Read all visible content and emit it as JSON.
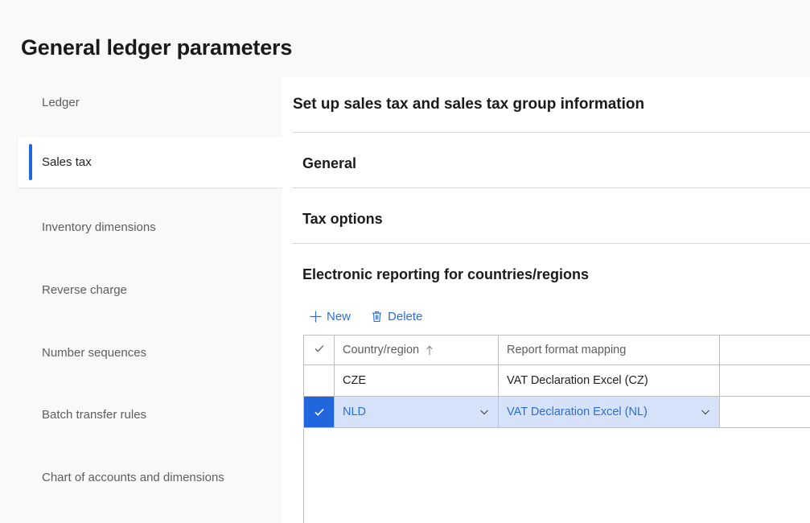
{
  "page": {
    "title": "General ledger parameters",
    "background_color": "#faf9f8",
    "accent_color": "#2266dd"
  },
  "sidebar": {
    "items": [
      {
        "label": "Ledger",
        "selected": false
      },
      {
        "label": "Sales tax",
        "selected": true
      },
      {
        "label": "Inventory dimensions",
        "selected": false
      },
      {
        "label": "Reverse charge",
        "selected": false
      },
      {
        "label": "Number sequences",
        "selected": false
      },
      {
        "label": "Batch transfer rules",
        "selected": false
      },
      {
        "label": "Chart of accounts and dimensions",
        "selected": false
      }
    ]
  },
  "main": {
    "header_title": "Set up sales tax and sales tax group information",
    "sections": [
      {
        "title": "General"
      },
      {
        "title": "Tax options"
      },
      {
        "title": "Electronic reporting for countries/regions"
      }
    ],
    "toolbar": {
      "new_label": "New",
      "new_icon": "plus-icon",
      "delete_label": "Delete",
      "delete_icon": "trash-icon"
    },
    "grid": {
      "select_all_icon": "checkmark-icon",
      "columns": [
        {
          "label": "Country/region",
          "sort": "ascending",
          "sort_icon": "arrow-up-icon"
        },
        {
          "label": "Report format mapping",
          "sort": "none"
        }
      ],
      "rows": [
        {
          "selected": false,
          "country": "CZE",
          "report_format_mapping": "VAT Declaration Excel (CZ)"
        },
        {
          "selected": true,
          "country": "NLD",
          "report_format_mapping": "VAT Declaration Excel (NL)"
        }
      ]
    }
  }
}
